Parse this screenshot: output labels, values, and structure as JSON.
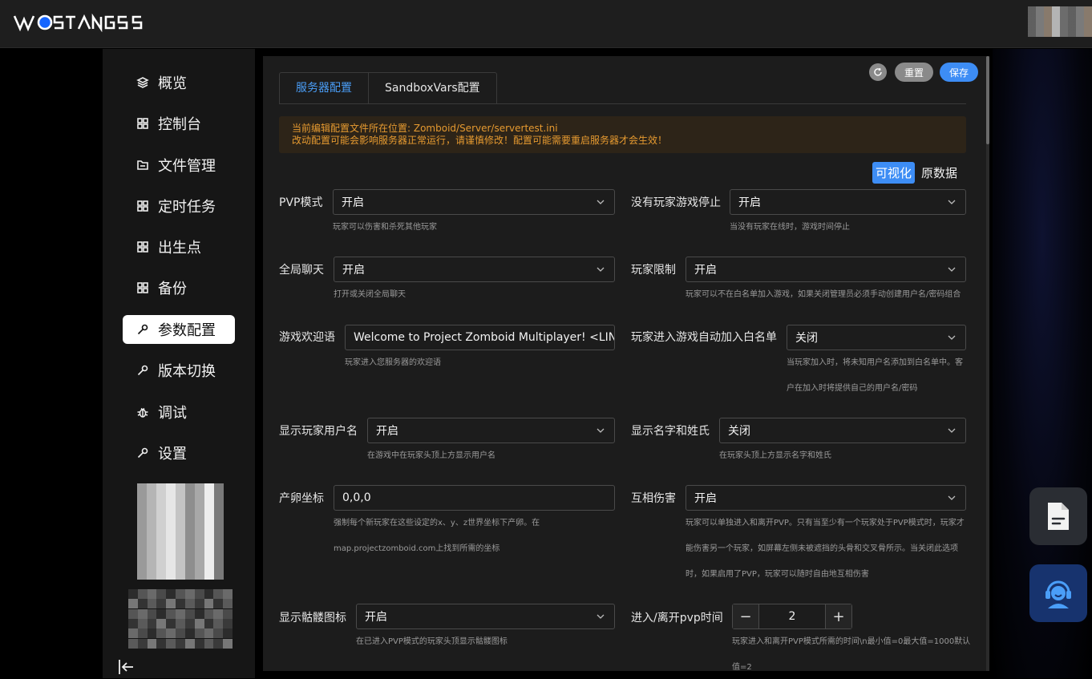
{
  "header": {
    "brand": "WOSTANGS",
    "avatar": "user-avatar"
  },
  "sidebar": {
    "items": [
      {
        "label": "概览",
        "icon": "layers-icon"
      },
      {
        "label": "控制台",
        "icon": "grid-icon"
      },
      {
        "label": "文件管理",
        "icon": "folder-icon"
      },
      {
        "label": "定时任务",
        "icon": "grid-icon"
      },
      {
        "label": "出生点",
        "icon": "grid-icon"
      },
      {
        "label": "备份",
        "icon": "grid-icon"
      },
      {
        "label": "参数配置",
        "icon": "wrench-icon",
        "active": true
      },
      {
        "label": "版本切换",
        "icon": "wrench-icon"
      },
      {
        "label": "调试",
        "icon": "bug-icon"
      },
      {
        "label": "设置",
        "icon": "wrench-icon"
      }
    ]
  },
  "toolbar": {
    "reset_label": "重置",
    "save_label": "保存"
  },
  "tabs": [
    {
      "label": "服务器配置",
      "active": true
    },
    {
      "label": "SandboxVars配置",
      "active": false
    }
  ],
  "alert": {
    "line1": "当前编辑配置文件所在位置: Zomboid/Server/servertest.ini",
    "line2": "改动配置可能会影响服务器正常运行，请谨慎修改！配置可能需要重启服务器才会生效！"
  },
  "view_toggle": {
    "visual": "可视化",
    "raw": "原数据"
  },
  "fields": {
    "pvp": {
      "label": "PVP模式",
      "value": "开启",
      "hint": "玩家可以伤害和杀死其他玩家"
    },
    "pause_empty": {
      "label": "没有玩家游戏停止",
      "value": "开启",
      "hint": "当没有玩家在线时，游戏时间停止"
    },
    "global_chat": {
      "label": "全局聊天",
      "value": "开启",
      "hint": "打开或关闭全局聊天"
    },
    "open": {
      "label": "玩家限制",
      "value": "开启",
      "hint": "玩家可以不在白名单加入游戏，如果关闭管理员必须手动创建用户名/密码组合"
    },
    "welcome": {
      "label": "游戏欢迎语",
      "value": "Welcome to Project Zomboid Multiplayer! <LINE> <",
      "hint": "玩家进入您服务器的欢迎语"
    },
    "auto_whitelist": {
      "label": "玩家进入游戏自动加入白名单",
      "value": "关闭",
      "hint1": "当玩家加入时，将未知用户名添加到白名单中。客",
      "hint2": "户在加入时将提供自己的用户名/密码"
    },
    "display_username": {
      "label": "显示玩家用户名",
      "value": "开启",
      "hint": "在游戏中在玩家头顶上方显示用户名"
    },
    "show_firstname": {
      "label": "显示名字和姓氏",
      "value": "关闭",
      "hint": "在玩家头顶上方显示名字和姓氏"
    },
    "spawn_point": {
      "label": "产卵坐标",
      "value": "0,0,0",
      "hint1": "强制每个新玩家在这些设定的x、y、z世界坐标下产卵。在",
      "hint2": "map.projectzomboid.com上找到所需的坐标"
    },
    "safety_system": {
      "label": "互相伤害",
      "value": "开启",
      "hint1": "玩家可以单独进入和离开PVP。只有当至少有一个玩家处于PVP模式时，玩家才",
      "hint2": "能伤害另一个玩家，如屏幕左侧未被遮挡的头骨和交叉骨所示。当关闭此选项",
      "hint3": "时，如果启用了PVP，玩家可以随时自由地互相伤害"
    },
    "show_skull": {
      "label": "显示骷髅图标",
      "value": "开启",
      "hint": "在已进入PVP模式的玩家头顶显示骷髅图标"
    },
    "safety_toggle_timer": {
      "label": "进入/离开pvp时间",
      "value": "2",
      "hint1": "玩家进入和离开PVP模式所需的时间\\n最小值=0最大值=1000默认",
      "hint2": "值=2"
    }
  },
  "floating": {
    "doc_icon": "document-icon",
    "support_icon": "headset-icon"
  }
}
